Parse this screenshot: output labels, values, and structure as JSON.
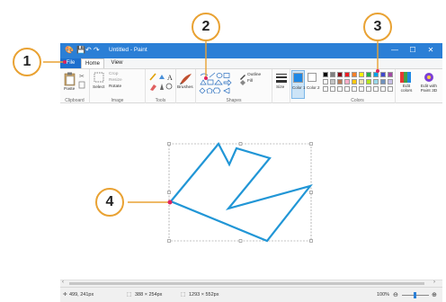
{
  "window": {
    "title": "Untitled - Paint",
    "controls": {
      "minimize": "—",
      "maximize": "☐",
      "close": "✕"
    }
  },
  "tabs": [
    {
      "label": "File"
    },
    {
      "label": "Home"
    },
    {
      "label": "View"
    }
  ],
  "ribbon": {
    "clipboard": {
      "label": "Clipboard",
      "paste": "Paste"
    },
    "image": {
      "label": "Image",
      "select": "Select",
      "crop": "Crop",
      "resize": "Resize",
      "rotate": "Rotate"
    },
    "tools": {
      "label": "Tools"
    },
    "brushes": {
      "label": "Brushes"
    },
    "shapes": {
      "label": "Shapes",
      "outline": "Outline",
      "fill": "Fill"
    },
    "size": {
      "label": "Size"
    },
    "color1": {
      "label": "Color 1"
    },
    "color2": {
      "label": "Color 2"
    },
    "colors": {
      "label": "Colors",
      "row1": [
        "#000000",
        "#7f7f7f",
        "#880015",
        "#ed1c24",
        "#ff7f27",
        "#fff200",
        "#22b14c",
        "#00a2e8",
        "#3f48cc",
        "#a349a4"
      ],
      "row2": [
        "#ffffff",
        "#c3c3c3",
        "#b97a57",
        "#ffaec9",
        "#ffc90e",
        "#efe4b0",
        "#b5e61d",
        "#99d9ea",
        "#7092be",
        "#c8bfe7"
      ],
      "row3": [
        "#ffffff",
        "#ffffff",
        "#ffffff",
        "#ffffff",
        "#ffffff",
        "#ffffff",
        "#ffffff",
        "#ffffff",
        "#ffffff",
        "#ffffff"
      ],
      "color1_value": "#1e88e5",
      "color2_value": "#ffffff"
    },
    "edit_colors": "Edit colors",
    "edit_paint3d": "Edit with Paint 3D"
  },
  "status": {
    "cursor": "499, 241px",
    "selection": "388 × 254px",
    "canvas": "1293 × 552px",
    "zoom": "100%"
  },
  "callouts": [
    "1",
    "2",
    "3",
    "4"
  ],
  "shape_color": "#2196d6",
  "callout_color": "#e9a233",
  "marker_color": "#e0245e"
}
